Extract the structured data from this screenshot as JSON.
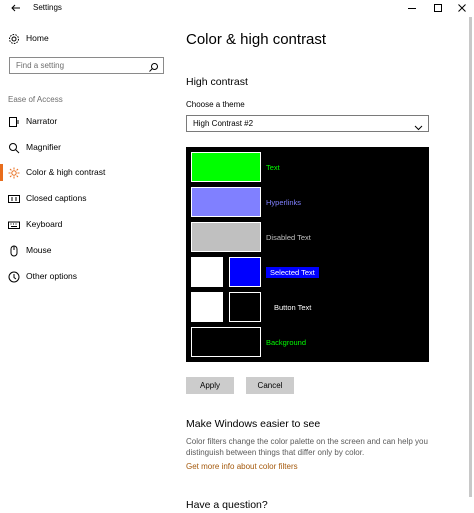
{
  "window": {
    "title": "Settings"
  },
  "sidebar": {
    "home_label": "Home",
    "search_placeholder": "Find a setting",
    "section_label": "Ease of Access",
    "items": [
      {
        "label": "Narrator",
        "icon": "narrator-icon"
      },
      {
        "label": "Magnifier",
        "icon": "magnifier-icon"
      },
      {
        "label": "Color & high contrast",
        "icon": "brightness-icon",
        "active": true
      },
      {
        "label": "Closed captions",
        "icon": "closed-captions-icon"
      },
      {
        "label": "Keyboard",
        "icon": "keyboard-icon"
      },
      {
        "label": "Mouse",
        "icon": "mouse-icon"
      },
      {
        "label": "Other options",
        "icon": "other-options-icon"
      }
    ],
    "accent_color": "#e86d1c"
  },
  "main": {
    "title": "Color & high contrast",
    "high_contrast_heading": "High contrast",
    "choose_theme_label": "Choose a theme",
    "theme_value": "High Contrast #2",
    "preview": {
      "text_label": "Text",
      "hyperlinks_label": "Hyperlinks",
      "disabled_label": "Disabled Text",
      "selected_label": "Selected Text",
      "button_label": "Button Text",
      "background_label": "Background",
      "colors": {
        "text": "#00ff00",
        "hyperlinks": "#8080ff",
        "disabled": "#c0c0c0",
        "selected_bg": "#0000ff",
        "selected_fg": "#ffffff",
        "button_bg": "#000000",
        "button_fg": "#ffffff",
        "background": "#000000"
      }
    },
    "apply_label": "Apply",
    "cancel_label": "Cancel",
    "make_easier_heading": "Make Windows easier to see",
    "make_easier_desc": "Color filters change the color palette on the screen and can help you distinguish between things that differ only by color.",
    "more_info_link": "Get more info about color filters",
    "question_heading": "Have a question?"
  }
}
